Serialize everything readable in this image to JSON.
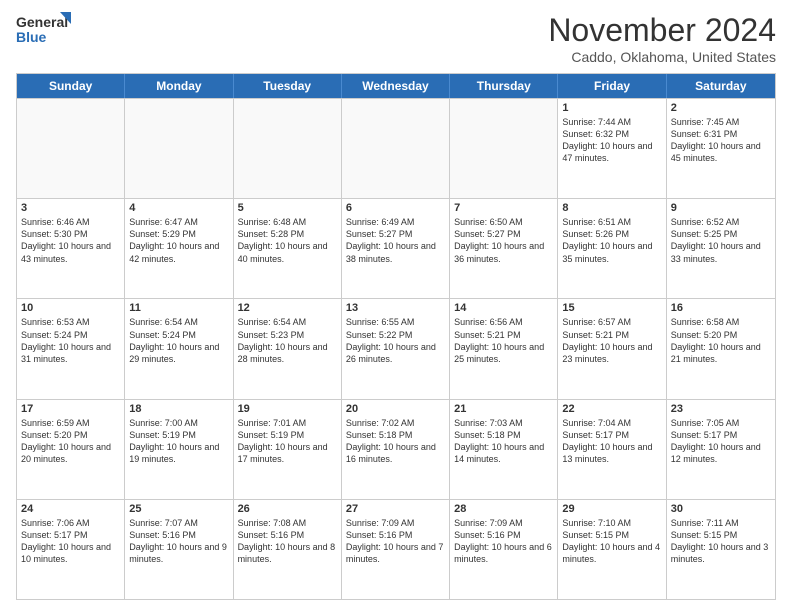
{
  "header": {
    "logo_line1": "General",
    "logo_line2": "Blue",
    "month_title": "November 2024",
    "subtitle": "Caddo, Oklahoma, United States"
  },
  "days_of_week": [
    "Sunday",
    "Monday",
    "Tuesday",
    "Wednesday",
    "Thursday",
    "Friday",
    "Saturday"
  ],
  "weeks": [
    [
      {
        "day": "",
        "info": ""
      },
      {
        "day": "",
        "info": ""
      },
      {
        "day": "",
        "info": ""
      },
      {
        "day": "",
        "info": ""
      },
      {
        "day": "",
        "info": ""
      },
      {
        "day": "1",
        "info": "Sunrise: 7:44 AM\nSunset: 6:32 PM\nDaylight: 10 hours and 47 minutes."
      },
      {
        "day": "2",
        "info": "Sunrise: 7:45 AM\nSunset: 6:31 PM\nDaylight: 10 hours and 45 minutes."
      }
    ],
    [
      {
        "day": "3",
        "info": "Sunrise: 6:46 AM\nSunset: 5:30 PM\nDaylight: 10 hours and 43 minutes."
      },
      {
        "day": "4",
        "info": "Sunrise: 6:47 AM\nSunset: 5:29 PM\nDaylight: 10 hours and 42 minutes."
      },
      {
        "day": "5",
        "info": "Sunrise: 6:48 AM\nSunset: 5:28 PM\nDaylight: 10 hours and 40 minutes."
      },
      {
        "day": "6",
        "info": "Sunrise: 6:49 AM\nSunset: 5:27 PM\nDaylight: 10 hours and 38 minutes."
      },
      {
        "day": "7",
        "info": "Sunrise: 6:50 AM\nSunset: 5:27 PM\nDaylight: 10 hours and 36 minutes."
      },
      {
        "day": "8",
        "info": "Sunrise: 6:51 AM\nSunset: 5:26 PM\nDaylight: 10 hours and 35 minutes."
      },
      {
        "day": "9",
        "info": "Sunrise: 6:52 AM\nSunset: 5:25 PM\nDaylight: 10 hours and 33 minutes."
      }
    ],
    [
      {
        "day": "10",
        "info": "Sunrise: 6:53 AM\nSunset: 5:24 PM\nDaylight: 10 hours and 31 minutes."
      },
      {
        "day": "11",
        "info": "Sunrise: 6:54 AM\nSunset: 5:24 PM\nDaylight: 10 hours and 29 minutes."
      },
      {
        "day": "12",
        "info": "Sunrise: 6:54 AM\nSunset: 5:23 PM\nDaylight: 10 hours and 28 minutes."
      },
      {
        "day": "13",
        "info": "Sunrise: 6:55 AM\nSunset: 5:22 PM\nDaylight: 10 hours and 26 minutes."
      },
      {
        "day": "14",
        "info": "Sunrise: 6:56 AM\nSunset: 5:21 PM\nDaylight: 10 hours and 25 minutes."
      },
      {
        "day": "15",
        "info": "Sunrise: 6:57 AM\nSunset: 5:21 PM\nDaylight: 10 hours and 23 minutes."
      },
      {
        "day": "16",
        "info": "Sunrise: 6:58 AM\nSunset: 5:20 PM\nDaylight: 10 hours and 21 minutes."
      }
    ],
    [
      {
        "day": "17",
        "info": "Sunrise: 6:59 AM\nSunset: 5:20 PM\nDaylight: 10 hours and 20 minutes."
      },
      {
        "day": "18",
        "info": "Sunrise: 7:00 AM\nSunset: 5:19 PM\nDaylight: 10 hours and 19 minutes."
      },
      {
        "day": "19",
        "info": "Sunrise: 7:01 AM\nSunset: 5:19 PM\nDaylight: 10 hours and 17 minutes."
      },
      {
        "day": "20",
        "info": "Sunrise: 7:02 AM\nSunset: 5:18 PM\nDaylight: 10 hours and 16 minutes."
      },
      {
        "day": "21",
        "info": "Sunrise: 7:03 AM\nSunset: 5:18 PM\nDaylight: 10 hours and 14 minutes."
      },
      {
        "day": "22",
        "info": "Sunrise: 7:04 AM\nSunset: 5:17 PM\nDaylight: 10 hours and 13 minutes."
      },
      {
        "day": "23",
        "info": "Sunrise: 7:05 AM\nSunset: 5:17 PM\nDaylight: 10 hours and 12 minutes."
      }
    ],
    [
      {
        "day": "24",
        "info": "Sunrise: 7:06 AM\nSunset: 5:17 PM\nDaylight: 10 hours and 10 minutes."
      },
      {
        "day": "25",
        "info": "Sunrise: 7:07 AM\nSunset: 5:16 PM\nDaylight: 10 hours and 9 minutes."
      },
      {
        "day": "26",
        "info": "Sunrise: 7:08 AM\nSunset: 5:16 PM\nDaylight: 10 hours and 8 minutes."
      },
      {
        "day": "27",
        "info": "Sunrise: 7:09 AM\nSunset: 5:16 PM\nDaylight: 10 hours and 7 minutes."
      },
      {
        "day": "28",
        "info": "Sunrise: 7:09 AM\nSunset: 5:16 PM\nDaylight: 10 hours and 6 minutes."
      },
      {
        "day": "29",
        "info": "Sunrise: 7:10 AM\nSunset: 5:15 PM\nDaylight: 10 hours and 4 minutes."
      },
      {
        "day": "30",
        "info": "Sunrise: 7:11 AM\nSunset: 5:15 PM\nDaylight: 10 hours and 3 minutes."
      }
    ]
  ]
}
